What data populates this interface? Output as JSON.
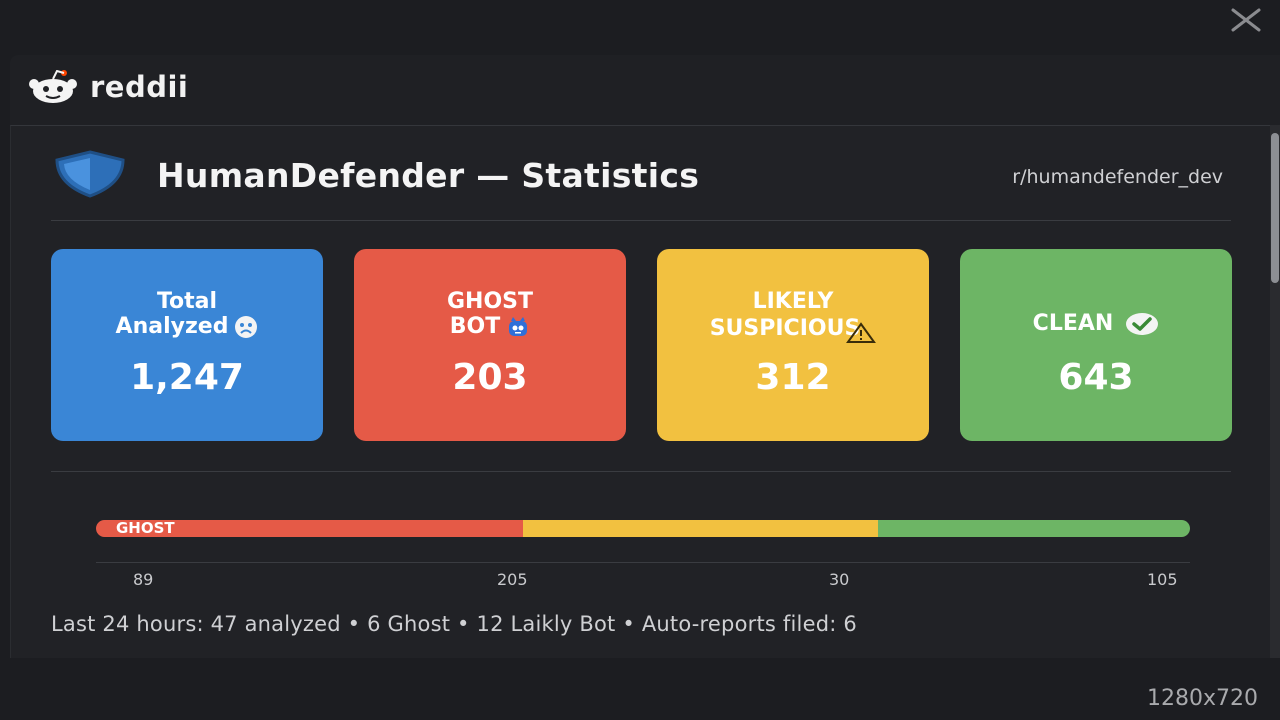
{
  "app": {
    "brand_name": "reddii",
    "close_icon": "close-icon"
  },
  "header": {
    "title": "HumanDefender — Statistics",
    "subreddit": "r/humandefender_dev",
    "icon": "shield-icon"
  },
  "cards": [
    {
      "label_line1": "Total",
      "label_line2": "Analyzed",
      "icon": "frown-face-icon",
      "value": "1,247",
      "color": "#3a86d6"
    },
    {
      "label_line1": "GHOST",
      "label_line2": "BOT",
      "icon": "robot-icon",
      "value": "203",
      "color": "#e55a47"
    },
    {
      "label_line1": "LIKELY",
      "label_line2": "SUSPICIOUS",
      "icon": "warning-icon",
      "value": "312",
      "color": "#f2c140"
    },
    {
      "label_line1": "CLEAN",
      "icon": "check-circle-icon",
      "value": "643",
      "color": "#6db565"
    }
  ],
  "distribution": {
    "bar_label": "GHOST",
    "segments": [
      {
        "fraction": 0.39,
        "color": "#e55a47"
      },
      {
        "fraction": 0.325,
        "color": "#f2c140"
      },
      {
        "fraction": 0.285,
        "color": "#6db565"
      }
    ],
    "ticks": [
      "89",
      "205",
      "30",
      "105"
    ]
  },
  "summary": "Last 24 hours: 47 analyzed • 6 Ghost • 12 Laikly Bot • Auto-reports filed: 6",
  "resolution_label": "1280x720"
}
